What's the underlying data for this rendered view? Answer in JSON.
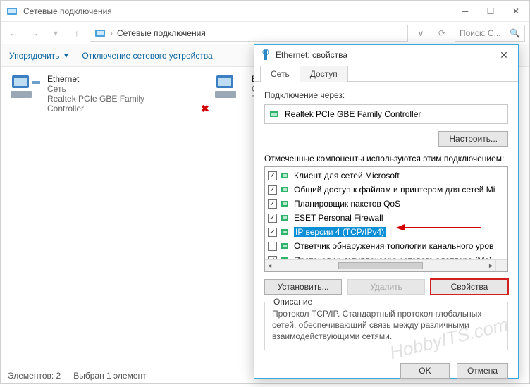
{
  "window": {
    "title": "Сетевые подключения",
    "breadcrumb": "Сетевые подключения",
    "search_placeholder": "Поиск: С..."
  },
  "cmdbar": {
    "organize": "Упорядочить",
    "disable": "Отключение сетевого устройства"
  },
  "connections": [
    {
      "name": "Ethernet",
      "sub1": "Сеть",
      "sub2": "Realtek PCIe GBE Family Controller"
    },
    {
      "name": "Ethe",
      "sub1": "Сет",
      "sub2": "TAP"
    }
  ],
  "statusbar": {
    "count_label": "Элементов: 2",
    "sel_label": "Выбран 1 элемент"
  },
  "dialog": {
    "title": "Ethernet: свойства",
    "tabs": {
      "net": "Сеть",
      "access": "Доступ"
    },
    "connect_via": "Подключение через:",
    "adapter": "Realtek PCIe GBE Family Controller",
    "configure_btn": "Настроить...",
    "list_label": "Отмеченные компоненты используются этим подключением:",
    "components": [
      {
        "checked": true,
        "label": "Клиент для сетей Microsoft",
        "hl": false
      },
      {
        "checked": true,
        "label": "Общий доступ к файлам и принтерам для сетей Mi",
        "hl": false
      },
      {
        "checked": true,
        "label": "Планировщик пакетов QoS",
        "hl": false
      },
      {
        "checked": true,
        "label": "ESET Personal Firewall",
        "hl": false
      },
      {
        "checked": true,
        "label": "IP версии 4 (TCP/IPv4)",
        "hl": true
      },
      {
        "checked": false,
        "label": "Ответчик обнаружения топологии канального уров",
        "hl": false
      },
      {
        "checked": true,
        "label": "Протокол мультиплексора сетевого адаптера (Ma)",
        "hl": false
      }
    ],
    "install_btn": "Установить...",
    "delete_btn": "Удалить",
    "props_btn": "Свойства",
    "desc_legend": "Описание",
    "desc_text": "Протокол TCP/IP. Стандартный протокол глобальных сетей, обеспечивающий связь между различными взаимодействующими сетями.",
    "ok_btn": "OK",
    "cancel_btn": "Отмена"
  }
}
